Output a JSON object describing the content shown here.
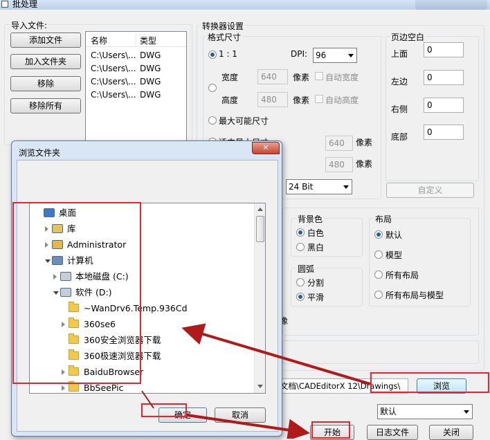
{
  "window": {
    "title": "批处理"
  },
  "import": {
    "group_title": "导入文件:",
    "add_file": "添加文件",
    "add_folder": "加入文件夹",
    "remove": "移除",
    "remove_all": "移除所有",
    "col_name": "名称",
    "col_type": "类型",
    "rows": [
      {
        "name": "C:\\Users\\...",
        "type": "DWG"
      },
      {
        "name": "C:\\Users\\...",
        "type": "DWG"
      },
      {
        "name": "C:\\Users\\...",
        "type": "DWG"
      },
      {
        "name": "C:\\Users\\...",
        "type": "DWG"
      }
    ]
  },
  "converter": {
    "title": "转换器设置",
    "format_size": "格式尺寸",
    "one_to_one": "1 : 1",
    "dpi_label": "DPI:",
    "dpi_value": "96",
    "width_label": "宽度",
    "width_value": "640",
    "height_label": "高度",
    "height_value": "480",
    "pixel": "像素",
    "auto_width": "自动宽度",
    "auto_height": "自动高度",
    "max_size": "最大可能尺寸",
    "fit_partial": "适中最大尺寸",
    "w2_value": "640",
    "h2_value": "480",
    "bit_depth": "24 Bit",
    "margins_title": "页边空白",
    "top": "上面",
    "top_value": "0",
    "left": "左边",
    "left_value": "0",
    "right": "右侧",
    "right_value": "0",
    "bottom": "底部",
    "bottom_value": "0",
    "custom": "自定义",
    "bg_title": "背景色",
    "bg_white": "白色",
    "bg_black": "黑白",
    "arc_title": "圆弧",
    "arc_split": "分割",
    "arc_smooth": "平滑",
    "layout_title": "布局",
    "layout_default": "默认",
    "layout_model": "模型",
    "layout_all": "所有布局",
    "layout_all_model": "所有布局与模型",
    "px_suffix": "像",
    "output_path": "文档\\CADEditorX 12\\Drawings\\",
    "browse": "浏览",
    "default": "默认",
    "start": "开始",
    "log": "日志文件",
    "close": "关闭"
  },
  "dialog": {
    "title": "浏览文件夹",
    "tree": [
      {
        "label": "桌面",
        "icon": "desktop-icon",
        "level": 0,
        "expander": "none"
      },
      {
        "label": "库",
        "icon": "library-icon",
        "level": 1,
        "expander": "closed"
      },
      {
        "label": "Administrator",
        "icon": "user-folder-icon",
        "level": 1,
        "expander": "closed"
      },
      {
        "label": "计算机",
        "icon": "computer-icon",
        "level": 1,
        "expander": "open"
      },
      {
        "label": "本地磁盘 (C:)",
        "icon": "drive-icon",
        "level": 2,
        "expander": "closed"
      },
      {
        "label": "软件 (D:)",
        "icon": "drive-icon",
        "level": 2,
        "expander": "open"
      },
      {
        "label": "~WanDrv6.Temp.936Cd",
        "icon": "folder-icon",
        "level": 3,
        "expander": "none"
      },
      {
        "label": "360se6",
        "icon": "folder-icon",
        "level": 3,
        "expander": "closed"
      },
      {
        "label": "360安全浏览器下载",
        "icon": "folder-icon",
        "level": 3,
        "expander": "none"
      },
      {
        "label": "360极速浏览器下载",
        "icon": "folder-icon",
        "level": 3,
        "expander": "none"
      },
      {
        "label": "BaiduBrowser",
        "icon": "folder-icon",
        "level": 3,
        "expander": "closed"
      },
      {
        "label": "BbSeePic",
        "icon": "folder-icon",
        "level": 3,
        "expander": "closed"
      }
    ],
    "ok": "确定",
    "cancel": "取消",
    "close_glyph": "✕"
  },
  "colors": {
    "annotation_red": "#e8232a",
    "annotation_arrow": "#b01a1a"
  }
}
